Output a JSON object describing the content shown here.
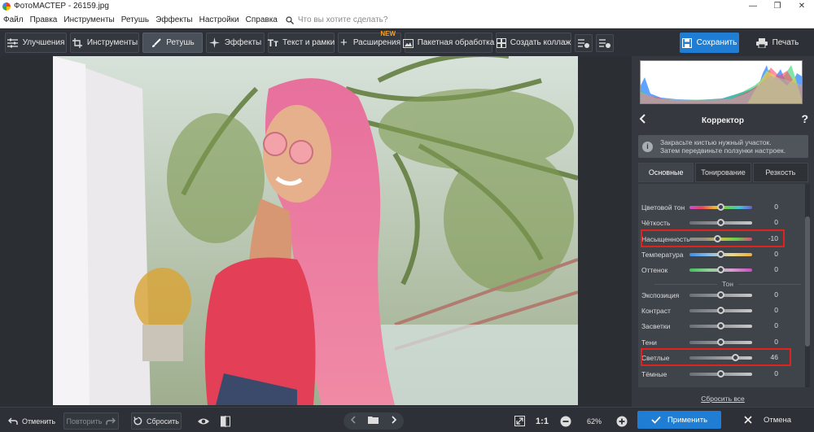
{
  "window": {
    "title": "ФотоМАСТЕР - 26159.jpg"
  },
  "menu": {
    "items": [
      "Файл",
      "Правка",
      "Инструменты",
      "Ретушь",
      "Эффекты",
      "Настройки",
      "Справка"
    ],
    "search_placeholder": "Что вы хотите сделать?"
  },
  "toolbar": {
    "tabs": [
      {
        "label": "Улучшения",
        "icon": "sliders-icon"
      },
      {
        "label": "Инструменты",
        "icon": "crop-icon"
      },
      {
        "label": "Ретушь",
        "icon": "brush-icon",
        "active": true
      },
      {
        "label": "Эффекты",
        "icon": "sparkle-icon"
      },
      {
        "label": "Текст и рамки",
        "icon": "text-icon"
      },
      {
        "label": "Расширения",
        "icon": "plus-icon",
        "badge": "NEW"
      },
      {
        "label": "Пакетная обработка",
        "icon": "images-icon"
      },
      {
        "label": "Создать коллаж",
        "icon": "collage-icon"
      }
    ],
    "save_label": "Сохранить",
    "print_label": "Печать"
  },
  "panel": {
    "title": "Корректор",
    "help": "?",
    "hint_line1": "Закрасьте кистью нужный участок.",
    "hint_line2": "Затем передвиньте ползунки настроек.",
    "tabs": [
      "Основные",
      "Тонирование",
      "Резкость"
    ],
    "active_tab": "Основные",
    "section_tone": "Тон",
    "reset_all": "Сбросить все",
    "sliders": [
      {
        "label": "Цветовой тон",
        "value": "0",
        "position": 0.5
      },
      {
        "label": "Чёткость",
        "value": "0",
        "position": 0.5
      },
      {
        "label": "Насыщенность",
        "value": "-10",
        "position": 0.45
      },
      {
        "label": "Температура",
        "value": "0",
        "position": 0.5
      },
      {
        "label": "Оттенок",
        "value": "0",
        "position": 0.5
      },
      {
        "label": "Экспозиция",
        "value": "0",
        "position": 0.5
      },
      {
        "label": "Контраст",
        "value": "0",
        "position": 0.5
      },
      {
        "label": "Засветки",
        "value": "0",
        "position": 0.5
      },
      {
        "label": "Тени",
        "value": "0",
        "position": 0.5
      },
      {
        "label": "Светлые",
        "value": "46",
        "position": 0.73
      },
      {
        "label": "Тёмные",
        "value": "0",
        "position": 0.5
      }
    ]
  },
  "bottom": {
    "undo_label": "Отменить",
    "redo_label": "Повторить",
    "reset_label": "Сбросить",
    "fit_label": "1:1",
    "zoom": "62%",
    "apply_label": "Применить",
    "cancel_label": "Отмена"
  },
  "colors": {
    "accent": "#1f7ed4",
    "highlight": "#e0231c",
    "badge": "#ff9f1a"
  }
}
